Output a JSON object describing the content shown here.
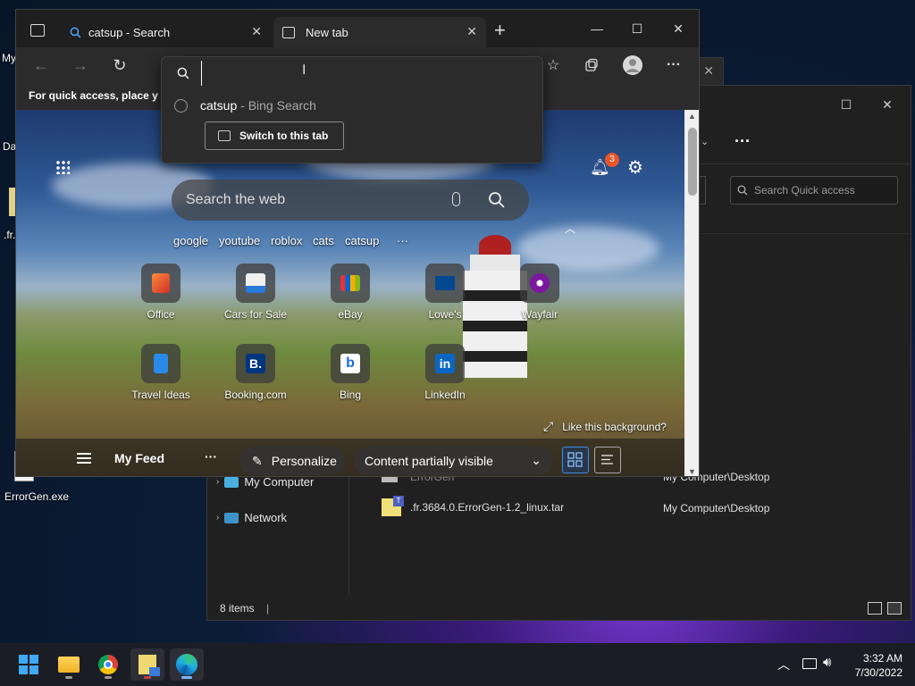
{
  "desktop": {
    "labels": [
      "My",
      "Da",
      ".fr.",
      "ErrorGen.exe"
    ]
  },
  "browser": {
    "tabs": [
      {
        "label": "catsup - Search"
      },
      {
        "label": "New tab"
      }
    ],
    "favorites_bar_text": "For quick access, place y",
    "address_value": "",
    "dropdown": {
      "suggestion_query": "catsup",
      "suggestion_source": " - Bing Search",
      "switch_button": "Switch to this tab"
    },
    "newtab": {
      "notification_count": "3",
      "search_placeholder": "Search the web",
      "quick_links": [
        "google",
        "youtube",
        "roblox",
        "cats",
        "catsup"
      ],
      "more_label": "···",
      "tiles": [
        {
          "label": "Office",
          "icon": "office-icon"
        },
        {
          "label": "Cars for Sale",
          "icon": "cars-icon"
        },
        {
          "label": "eBay",
          "icon": "ebay-icon"
        },
        {
          "label": "Lowe's",
          "icon": "lowes-icon"
        },
        {
          "label": "Wayfair",
          "icon": "wayfair-icon"
        },
        {
          "label": "Travel Ideas",
          "icon": "travel-icon"
        },
        {
          "label": "Booking.com",
          "icon": "booking-icon"
        },
        {
          "label": "Bing",
          "icon": "bing-icon"
        },
        {
          "label": "LinkedIn",
          "icon": "linkedin-icon"
        }
      ],
      "like_background": "Like this background?",
      "feed": {
        "my_feed": "My Feed",
        "more": "···",
        "personalize": "Personalize",
        "content_visible": "Content partially visible"
      }
    }
  },
  "explorer": {
    "search_placeholder": "Search Quick access",
    "more_label": "···",
    "nav": [
      {
        "label": "My Computer"
      },
      {
        "label": "Network"
      }
    ],
    "files": [
      {
        "name": "ErrorGen",
        "location": "My Computer\\Desktop"
      },
      {
        "name": ".fr.3684.0.ErrorGen-1.2_linux.tar",
        "location": "My Computer\\Desktop"
      }
    ],
    "status": "8 items"
  },
  "taskbar": {
    "time": "3:32 AM",
    "date": "7/30/2022"
  },
  "colors": {
    "accent": "#0078d4",
    "badge": "#e8572a"
  }
}
